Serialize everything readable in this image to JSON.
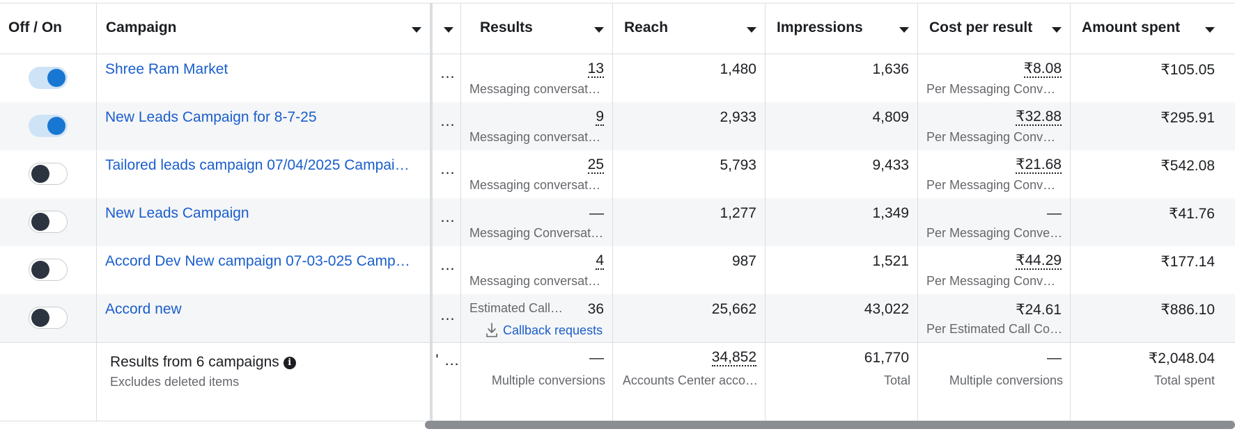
{
  "header": {
    "toggle_col": "Off / On",
    "campaign_col": "Campaign",
    "results_col": "Results",
    "reach_col": "Reach",
    "impressions_col": "Impressions",
    "cpr_col": "Cost per result",
    "amount_col": "Amount spent"
  },
  "rows": [
    {
      "on": true,
      "campaign": "Shree Ram Market",
      "dots": "…",
      "results": "13",
      "results_sub": "Messaging conversat…",
      "reach": "1,480",
      "impressions": "1,636",
      "cpr": "₹8.08",
      "cpr_sub": "Per Messaging Conv…",
      "amount": "₹105.05"
    },
    {
      "on": true,
      "campaign": "New Leads Campaign for 8-7-25",
      "dots": "…",
      "results": "9",
      "results_sub": "Messaging conversat…",
      "reach": "2,933",
      "impressions": "4,809",
      "cpr": "₹32.88",
      "cpr_sub": "Per Messaging Conv…",
      "amount": "₹295.91"
    },
    {
      "on": false,
      "campaign": "Tailored leads campaign 07/04/2025 Campai…",
      "dots": "…",
      "results": "25",
      "results_sub": "Messaging conversat…",
      "reach": "5,793",
      "impressions": "9,433",
      "cpr": "₹21.68",
      "cpr_sub": "Per Messaging Conv…",
      "amount": "₹542.08"
    },
    {
      "on": false,
      "campaign": "New Leads Campaign",
      "dots": "…",
      "results": "—",
      "results_sub": "Messaging Conversati…",
      "reach": "1,277",
      "impressions": "1,349",
      "cpr": "—",
      "cpr_sub": "Per Messaging Conve…",
      "amount": "₹41.76"
    },
    {
      "on": false,
      "campaign": "Accord Dev New campaign 07-03-025 Camp…",
      "dots": "…",
      "results": "4",
      "results_sub": "Messaging conversat…",
      "reach": "987",
      "impressions": "1,521",
      "cpr": "₹44.29",
      "cpr_sub": "Per Messaging Conv…",
      "amount": "₹177.14"
    },
    {
      "on": false,
      "campaign": "Accord new",
      "dots": "…",
      "results_est": "Estimated Call C…",
      "results": "36",
      "callback_label": "Callback requests",
      "reach": "25,662",
      "impressions": "43,022",
      "cpr": "₹24.61",
      "cpr_sub": "Per Estimated Call Co…",
      "amount": "₹886.10"
    }
  ],
  "summary": {
    "title": "Results from 6 campaigns",
    "subtitle": "Excludes deleted items",
    "dots": "' …",
    "results": "—",
    "results_sub": "Multiple conversions",
    "reach": "34,852",
    "reach_sub": "Accounts Center acco…",
    "impressions": "61,770",
    "impressions_sub": "Total",
    "cpr": "—",
    "cpr_sub": "Multiple conversions",
    "amount": "₹2,048.04",
    "amount_sub": "Total spent"
  },
  "icons": {
    "sort_caret": "chevron-down-icon",
    "info": "info-icon",
    "download": "download-icon"
  },
  "colors": {
    "link": "#1a5ecc",
    "toggle_on": "#1877d2",
    "row_alt": "#f5f6f7"
  }
}
